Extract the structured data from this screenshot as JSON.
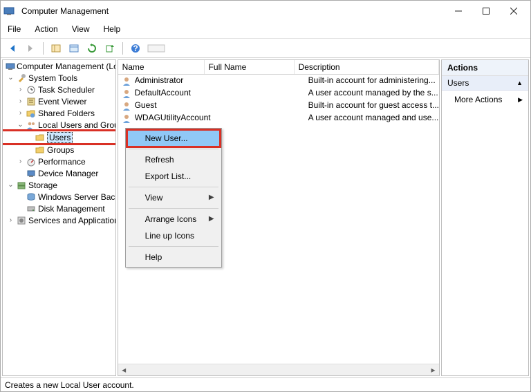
{
  "window": {
    "title": "Computer Management"
  },
  "menubar": [
    "File",
    "Action",
    "View",
    "Help"
  ],
  "tree": {
    "root": "Computer Management (Local)",
    "system_tools": "System Tools",
    "task_scheduler": "Task Scheduler",
    "event_viewer": "Event Viewer",
    "shared_folders": "Shared Folders",
    "local_users": "Local Users and Groups",
    "users": "Users",
    "groups": "Groups",
    "performance": "Performance",
    "device_manager": "Device Manager",
    "storage": "Storage",
    "wsb": "Windows Server Backup",
    "disk_mgmt": "Disk Management",
    "services": "Services and Applications"
  },
  "list": {
    "col_name": "Name",
    "col_full": "Full Name",
    "col_desc": "Description",
    "rows": [
      {
        "name": "Administrator",
        "full": "",
        "desc": "Built-in account for administering..."
      },
      {
        "name": "DefaultAccount",
        "full": "",
        "desc": "A user account managed by the s..."
      },
      {
        "name": "Guest",
        "full": "",
        "desc": "Built-in account for guest access t..."
      },
      {
        "name": "WDAGUtilityAccount",
        "full": "",
        "desc": "A user account managed and use..."
      }
    ]
  },
  "context_menu": {
    "new_user": "New User...",
    "refresh": "Refresh",
    "export_list": "Export List...",
    "view": "View",
    "arrange": "Arrange Icons",
    "lineup": "Line up Icons",
    "help": "Help"
  },
  "actions": {
    "header": "Actions",
    "sub": "Users",
    "more": "More Actions"
  },
  "status": "Creates a new Local User account."
}
